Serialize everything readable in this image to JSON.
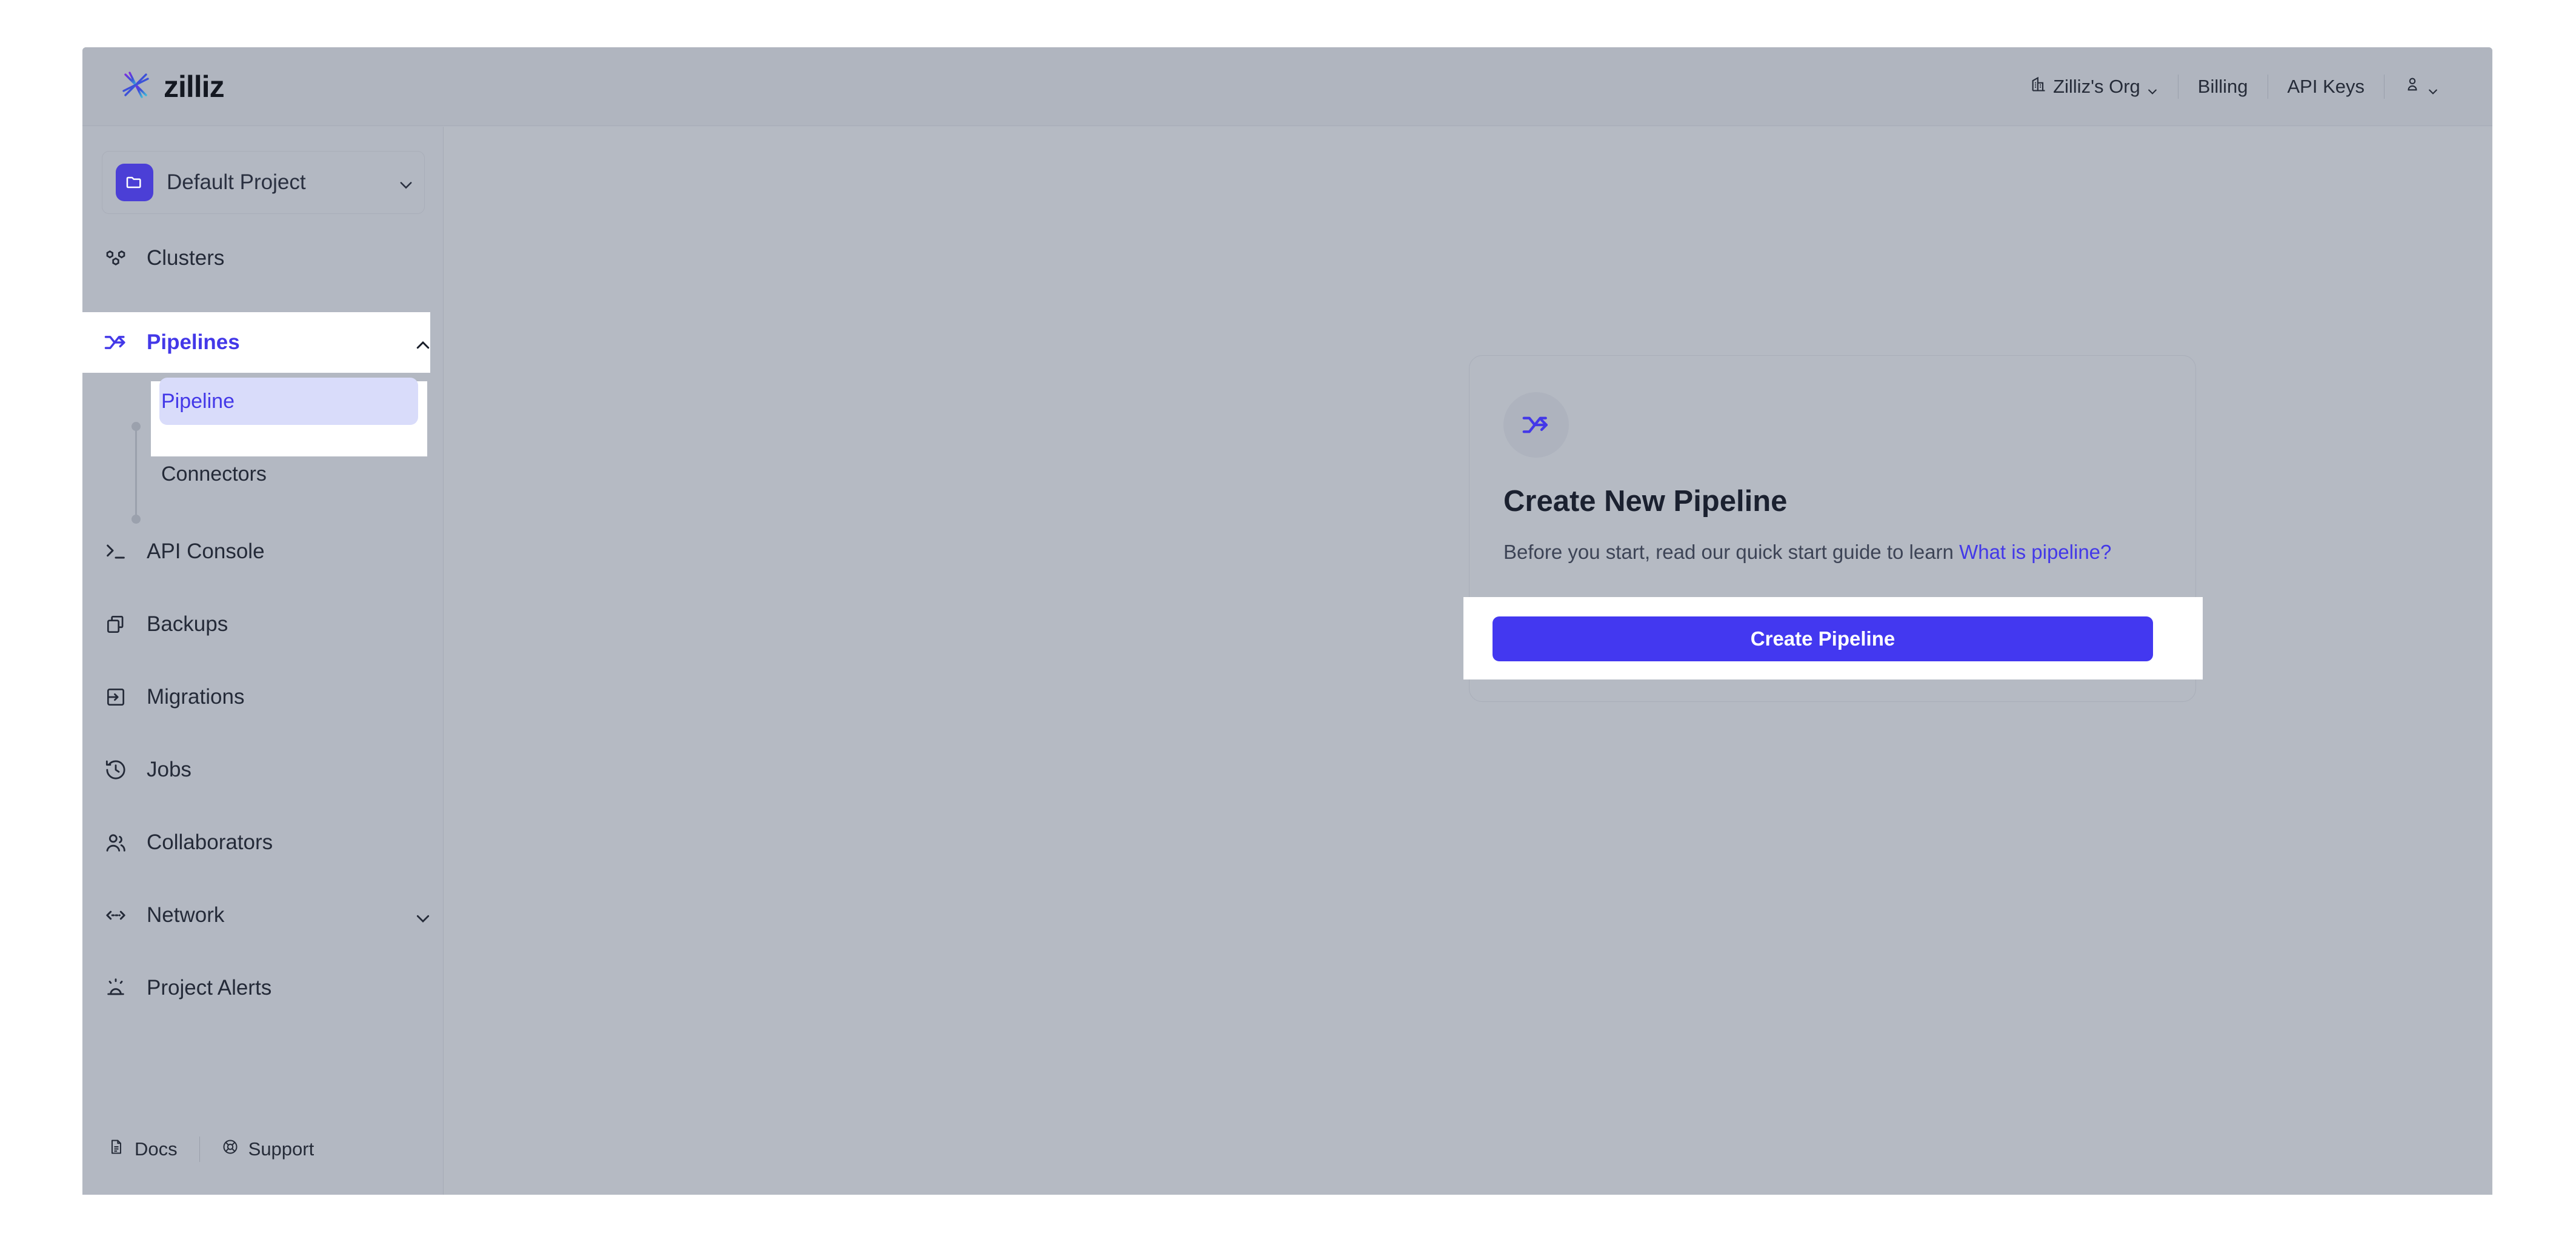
{
  "brand": {
    "wordmark": "zilliz",
    "logo_icon": "zilliz-starburst-icon"
  },
  "topnav": {
    "org": {
      "label": "Zilliz's Org",
      "icon": "building-icon",
      "chevron": "chevron-down-icon"
    },
    "billing": "Billing",
    "api_keys": "API Keys",
    "account": {
      "icon": "user-icon",
      "chevron": "chevron-down-icon"
    }
  },
  "sidebar": {
    "project": {
      "name": "Default Project",
      "icon": "folder-icon",
      "chevron": "chevron-down-icon"
    },
    "items": [
      {
        "label": "Clusters",
        "icon": "hexagon-cluster-icon",
        "active": false
      },
      {
        "label": "Pipelines",
        "icon": "pipeline-merge-icon",
        "active": true,
        "expanded": true,
        "chevron": "chevron-up-icon"
      },
      {
        "label": "API Console",
        "icon": "terminal-prompt-icon",
        "active": false
      },
      {
        "label": "Backups",
        "icon": "copy-stack-icon",
        "active": false
      },
      {
        "label": "Migrations",
        "icon": "box-arrow-in-icon",
        "active": false
      },
      {
        "label": "Jobs",
        "icon": "clock-rewind-icon",
        "active": false
      },
      {
        "label": "Collaborators",
        "icon": "users-icon",
        "active": false
      },
      {
        "label": "Network",
        "icon": "network-arrows-icon",
        "active": false,
        "chevron": "chevron-down-icon"
      },
      {
        "label": "Project Alerts",
        "icon": "siren-icon",
        "active": false
      }
    ],
    "sub_items": [
      {
        "label": "Pipeline",
        "selected": true
      },
      {
        "label": "Connectors",
        "selected": false
      }
    ]
  },
  "footer": {
    "docs": {
      "label": "Docs",
      "icon": "document-icon"
    },
    "support": {
      "label": "Support",
      "icon": "lifebuoy-icon"
    },
    "collapse": {
      "icon": "chevron-left-icon"
    }
  },
  "main": {
    "card": {
      "icon": "pipeline-merge-icon",
      "title": "Create New Pipeline",
      "description_prefix": "Before you start, read our quick start guide to learn ",
      "description_link": "What is pipeline?",
      "primary_button": "Create Pipeline"
    }
  },
  "colors": {
    "accent": "#4338f0",
    "accent_soft": "#d9dcfa",
    "project_badge": "#4b3fd6",
    "app_background": "#b3b8c2",
    "text": "#242a38"
  }
}
